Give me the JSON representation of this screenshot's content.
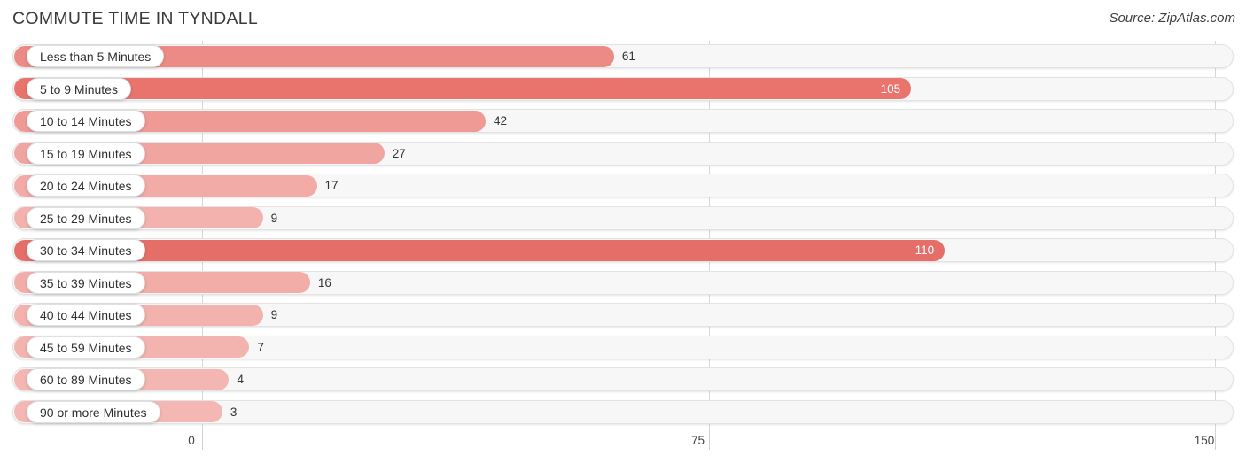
{
  "header": {
    "title": "COMMUTE TIME IN TYNDALL",
    "source": "Source: ZipAtlas.com"
  },
  "chart_data": {
    "type": "bar",
    "orientation": "horizontal",
    "title": "COMMUTE TIME IN TYNDALL",
    "xlabel": "",
    "ylabel": "",
    "xlim": [
      0,
      150
    ],
    "xticks": [
      0,
      75,
      150
    ],
    "xtick_labels": [
      "0",
      "75",
      "150"
    ],
    "grid": true,
    "legend": null,
    "categories": [
      "Less than 5 Minutes",
      "5 to 9 Minutes",
      "10 to 14 Minutes",
      "15 to 19 Minutes",
      "20 to 24 Minutes",
      "25 to 29 Minutes",
      "30 to 34 Minutes",
      "35 to 39 Minutes",
      "40 to 44 Minutes",
      "45 to 59 Minutes",
      "60 to 89 Minutes",
      "90 or more Minutes"
    ],
    "values": [
      61,
      105,
      42,
      27,
      17,
      9,
      110,
      16,
      9,
      7,
      4,
      3
    ],
    "value_labels": [
      "61",
      "105",
      "42",
      "27",
      "17",
      "9",
      "110",
      "16",
      "9",
      "7",
      "4",
      "3"
    ],
    "bar_colors": [
      "#ec8b85",
      "#e8746d",
      "#ef9a95",
      "#f1a5a1",
      "#f2aba7",
      "#f3b2ae",
      "#e56f68",
      "#f2ada9",
      "#f3b2ae",
      "#f3b4b0",
      "#f3b6b2",
      "#f4b7b3"
    ],
    "label_inside": [
      false,
      true,
      false,
      false,
      false,
      false,
      true,
      false,
      false,
      false,
      false,
      false
    ]
  },
  "colors": {
    "accent": "#e8746d",
    "accent_light": "#f4b7b3",
    "track": "#f7f7f7",
    "gridline": "#d8d8d8",
    "text": "#3c3c3c"
  }
}
